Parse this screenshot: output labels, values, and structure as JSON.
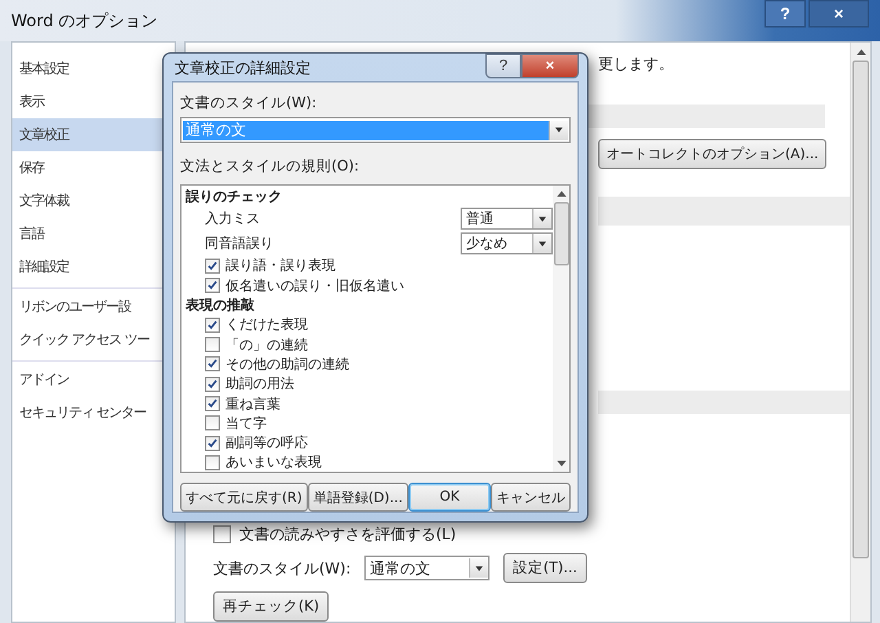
{
  "window": {
    "title": "Word のオプション",
    "buttons": [
      "?",
      "×"
    ]
  },
  "sidebar": {
    "groups": [
      [
        {
          "label": "基本設定",
          "selected": false
        },
        {
          "label": "表示",
          "selected": false
        },
        {
          "label": "文章校正",
          "selected": true
        },
        {
          "label": "保存",
          "selected": false
        },
        {
          "label": "文字体裁",
          "selected": false
        },
        {
          "label": "言語",
          "selected": false
        },
        {
          "label": "詳細設定",
          "selected": false
        }
      ],
      [
        {
          "label": "リボンのユーザー設",
          "selected": false
        },
        {
          "label": "クイック アクセス ツー",
          "selected": false
        }
      ],
      [
        {
          "label": "アドイン",
          "selected": false
        },
        {
          "label": "セキュリティ センター",
          "selected": false
        }
      ]
    ]
  },
  "content": {
    "intro": "更します。",
    "autocorrect_button": "オートコレクトのオプション(A)...",
    "readability": {
      "label": "文書の読みやすさを評価する(L)",
      "checked": false
    },
    "style_label": "文書のスタイル(W):",
    "style_value": "通常の文",
    "settings_button": "設定(T)...",
    "recheck_button": "再チェック(K)"
  },
  "dialog": {
    "title": "文章校正の詳細設定",
    "buttons": [
      "?",
      "×"
    ],
    "style_label": "文書のスタイル(W):",
    "style_value": "通常の文",
    "rules_label": "文法とスタイルの規則(O):",
    "rules": [
      {
        "kind": "heading",
        "label": "誤りのチェック"
      },
      {
        "kind": "select",
        "label": "入力ミス",
        "value": "普通"
      },
      {
        "kind": "select",
        "label": "同音語誤り",
        "value": "少なめ"
      },
      {
        "kind": "check",
        "label": "誤り語・誤り表現",
        "checked": true
      },
      {
        "kind": "check",
        "label": "仮名遣いの誤り・旧仮名遣い",
        "checked": true
      },
      {
        "kind": "heading",
        "label": "表現の推敲"
      },
      {
        "kind": "check",
        "label": "くだけた表現",
        "checked": true
      },
      {
        "kind": "check",
        "label": "「の」の連続",
        "checked": false
      },
      {
        "kind": "check",
        "label": "その他の助詞の連続",
        "checked": true
      },
      {
        "kind": "check",
        "label": "助詞の用法",
        "checked": true
      },
      {
        "kind": "check",
        "label": "重ね言葉",
        "checked": true
      },
      {
        "kind": "check",
        "label": "当て字",
        "checked": false
      },
      {
        "kind": "check",
        "label": "副詞等の呼応",
        "checked": true
      },
      {
        "kind": "check",
        "label": "あいまいな表現",
        "checked": false
      }
    ],
    "footer_buttons": [
      {
        "label": "すべて元に戻す(R)",
        "default": false
      },
      {
        "label": "単語登録(D)...",
        "default": false
      },
      {
        "label": "OK",
        "default": true
      },
      {
        "label": "キャンセル",
        "default": false
      }
    ]
  }
}
